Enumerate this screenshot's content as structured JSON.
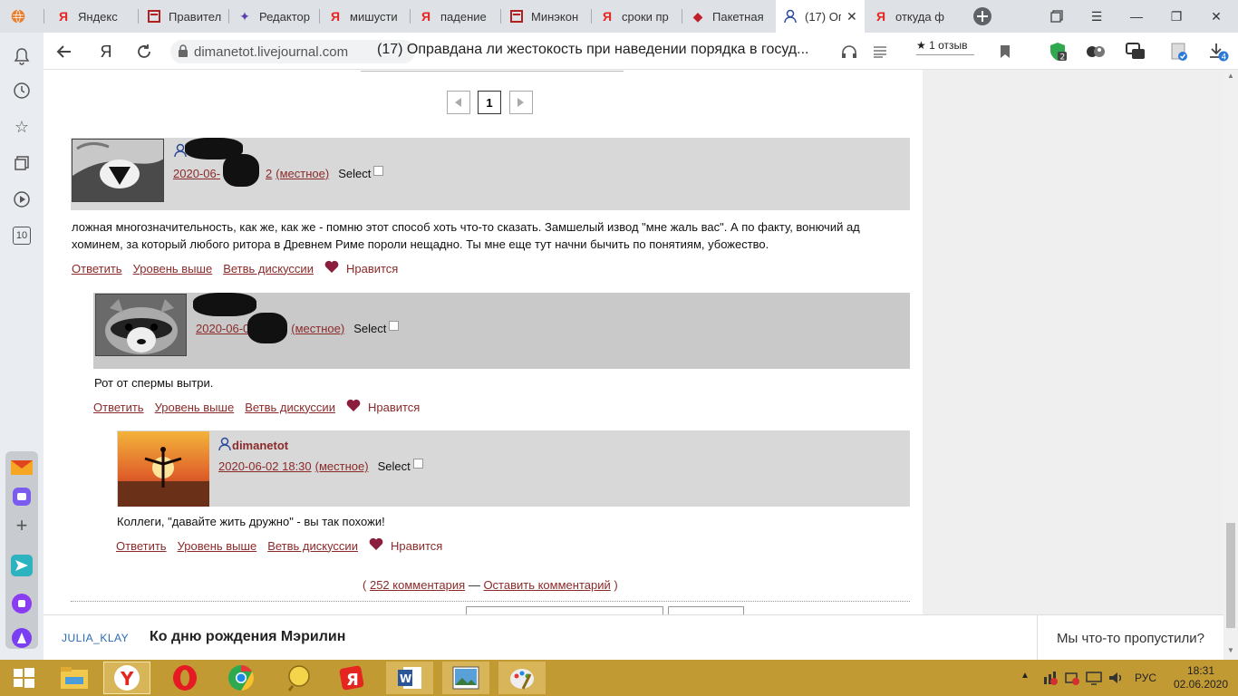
{
  "tabs": [
    {
      "label": "",
      "icon": "globe-icon",
      "active": false
    },
    {
      "label": "Яндекс",
      "icon": "yandex-icon",
      "active": false
    },
    {
      "label": "Правител",
      "icon": "page-icon",
      "active": false
    },
    {
      "label": "Редактор",
      "icon": "sparkle-icon",
      "active": false
    },
    {
      "label": "мишусти",
      "icon": "yandex-icon",
      "active": false
    },
    {
      "label": "падение",
      "icon": "yandex-icon",
      "active": false
    },
    {
      "label": "Минэкон",
      "icon": "page-icon",
      "active": false
    },
    {
      "label": "сроки пр",
      "icon": "yandex-icon",
      "active": false
    },
    {
      "label": "Пакетная",
      "icon": "diamond-icon",
      "active": false
    },
    {
      "label": "(17) Оп",
      "icon": "user-icon",
      "active": true
    },
    {
      "label": "откуда ф",
      "icon": "yandex-icon",
      "active": false
    }
  ],
  "address": {
    "url": "dimanetot.livejournal.com",
    "title": "(17) Оправдана ли жестокость при наведении порядка в госуд...",
    "reviews": "★ 1 отзыв"
  },
  "left_sidebar": {
    "counter": "10"
  },
  "pager": {
    "current": "1"
  },
  "comments": [
    {
      "date": "2020-06-",
      "date_tail": "2",
      "local": "(местное)",
      "select": "Select",
      "username": "",
      "text": "ложная многозначительность, как же, как же - помню этот способ хоть что-то сказать. Замшелый извод \"мне жаль вас\". А по факту, вонючий ад хоминем, за который любого ритора в Древнем Риме пороли нещадно. Ты мне еще тут начни бычить по понятиям, убожество.",
      "actions": [
        "Ответить",
        "Уровень выше",
        "Ветвь дискуссии"
      ],
      "like": "Нравится"
    },
    {
      "date": "2020-06-0",
      "date_tail": "",
      "local": "(местное)",
      "select": "Select",
      "username": "",
      "text": "Рот от спермы вытри.",
      "actions": [
        "Ответить",
        "Уровень выше",
        "Ветвь дискуссии"
      ],
      "like": "Нравится"
    },
    {
      "date": "2020-06-02 18:30",
      "date_tail": "",
      "local": "(местное)",
      "select": "Select",
      "username": "dimanetot",
      "text": "Коллеги, \"давайте жить дружно\" - вы так похожи!",
      "actions": [
        "Ответить",
        "Уровень выше",
        "Ветвь дискуссии"
      ],
      "like": "Нравится"
    }
  ],
  "footer_links": {
    "open": "(",
    "comments_count": "252 комментария",
    "dash": "—",
    "leave_comment": "Оставить комментарий",
    "close": ")"
  },
  "bottom_bar": {
    "author": "JULIA_KLAY",
    "headline": "Ко дню рождения Мэрилин",
    "missed": "Мы что-то пропустили?"
  },
  "taskbar": {
    "lang": "РУС",
    "time": "18:31",
    "date": "02.06.2020"
  },
  "colors": {
    "link": "#8b2a2a",
    "comment_header": "#d8d8d8",
    "taskbar": "#c19a33",
    "bottom_author": "#2a6bb5"
  }
}
